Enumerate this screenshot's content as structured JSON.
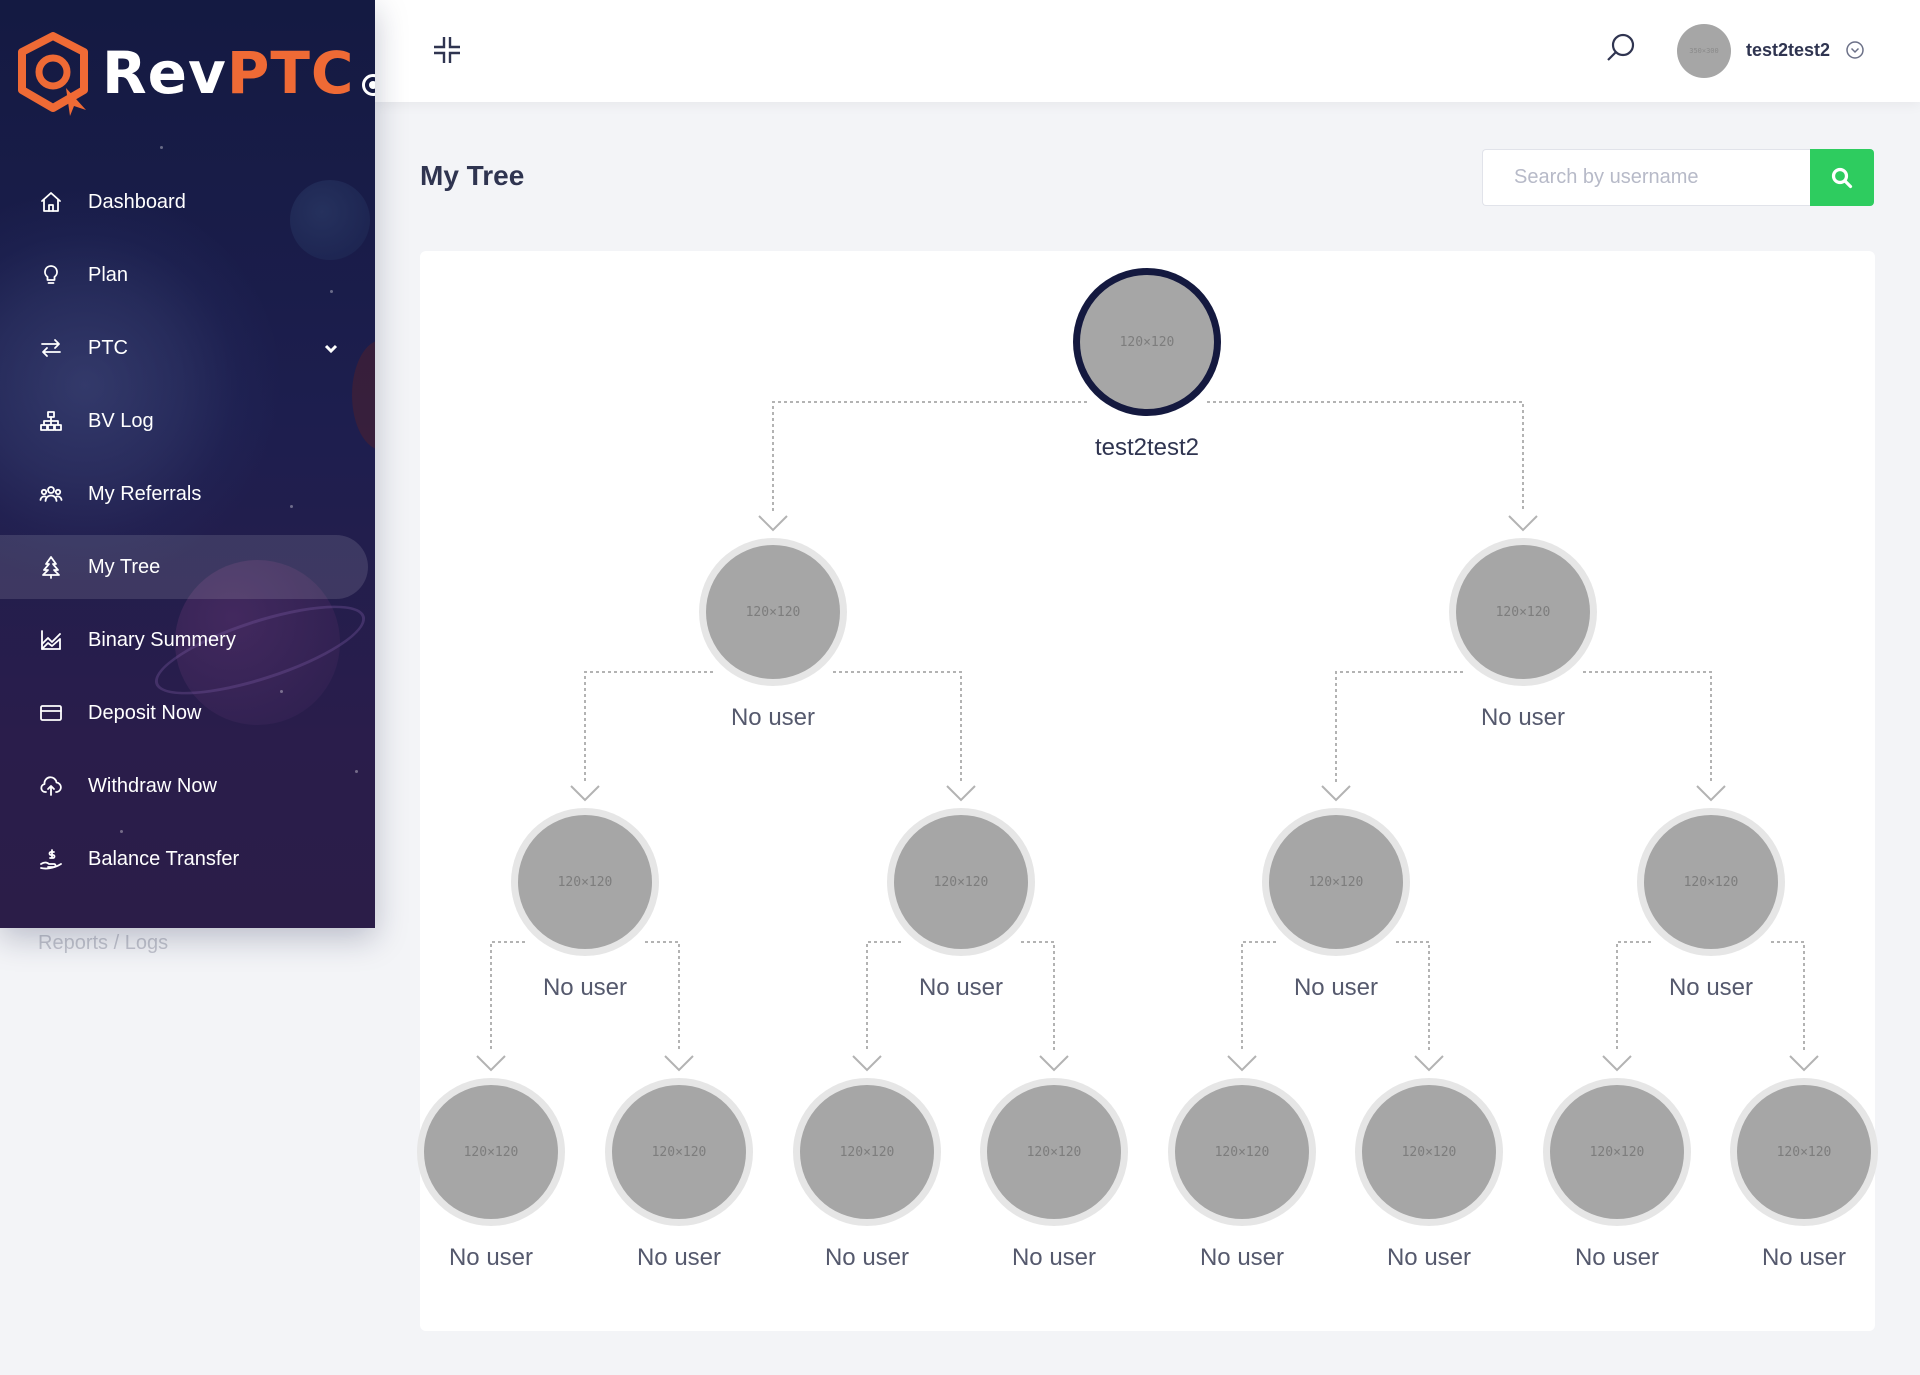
{
  "brand": {
    "name_part1": "Rev",
    "name_part2": "PTC"
  },
  "sidebar": {
    "items": [
      {
        "label": "Dashboard",
        "icon": "home-icon"
      },
      {
        "label": "Plan",
        "icon": "lightbulb-icon"
      },
      {
        "label": "PTC",
        "icon": "transfer-arrows-icon",
        "expandable": true
      },
      {
        "label": "BV Log",
        "icon": "sitemap-icon"
      },
      {
        "label": "My Referrals",
        "icon": "users-icon"
      },
      {
        "label": "My Tree",
        "icon": "tree-icon",
        "active": true
      },
      {
        "label": "Binary Summery",
        "icon": "chart-icon"
      },
      {
        "label": "Deposit Now",
        "icon": "credit-card-icon"
      },
      {
        "label": "Withdraw Now",
        "icon": "cloud-upload-icon"
      },
      {
        "label": "Balance Transfer",
        "icon": "hand-money-icon"
      }
    ]
  },
  "topbar": {
    "avatar_placeholder": "350×300",
    "username": "test2test2"
  },
  "main": {
    "page_title": "My Tree",
    "search_placeholder": "Search by username"
  },
  "tree": {
    "image_placeholder": "120×120",
    "root": {
      "label": "test2test2"
    },
    "level1": [
      "No user",
      "No user"
    ],
    "level2": [
      "No user",
      "No user",
      "No user",
      "No user"
    ],
    "level3": [
      "No user",
      "No user",
      "No user",
      "No user",
      "No user",
      "No user",
      "No user",
      "No user"
    ]
  }
}
